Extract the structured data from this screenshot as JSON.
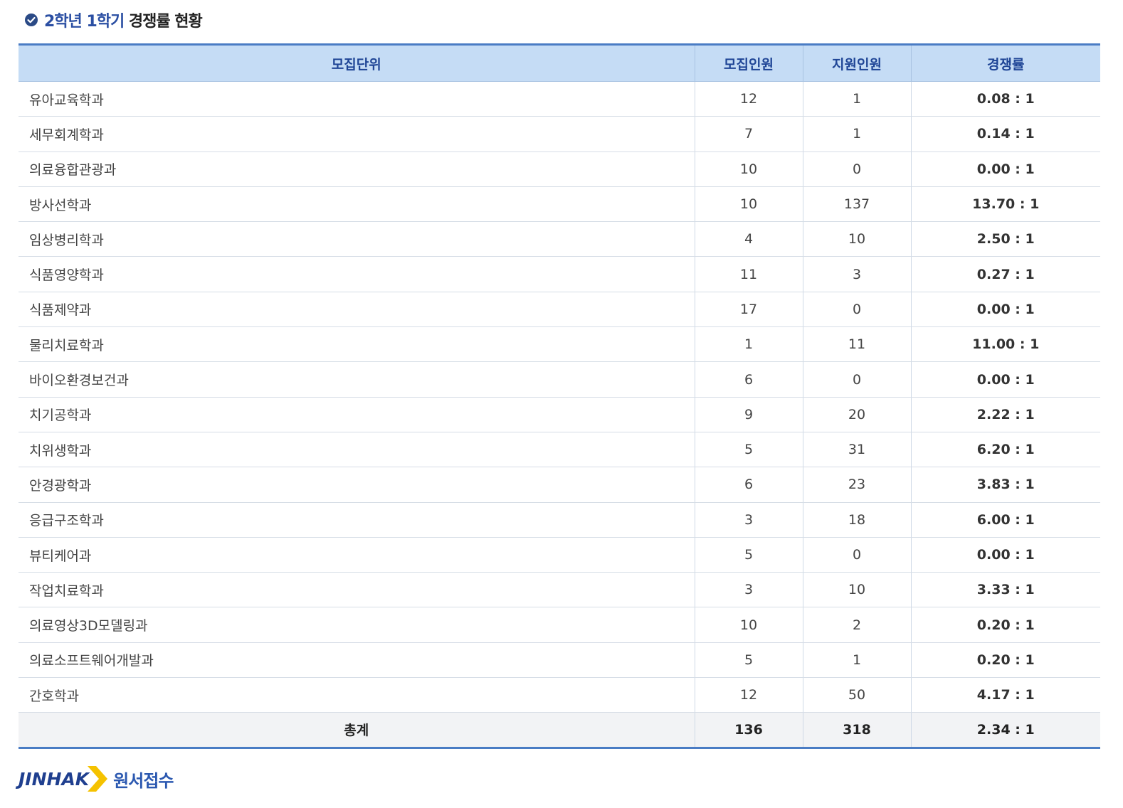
{
  "header": {
    "title_highlight": "2학년 1학기",
    "title_rest": "경쟁률 현황",
    "icon": "check-circle-icon"
  },
  "table": {
    "columns": [
      "모집단위",
      "모집인원",
      "지원인원",
      "경쟁률"
    ],
    "rows": [
      {
        "unit": "유아교육학과",
        "quota": "12",
        "applicants": "1",
        "ratio": "0.08 : 1"
      },
      {
        "unit": "세무회계학과",
        "quota": "7",
        "applicants": "1",
        "ratio": "0.14 : 1"
      },
      {
        "unit": "의료융합관광과",
        "quota": "10",
        "applicants": "0",
        "ratio": "0.00 : 1"
      },
      {
        "unit": "방사선학과",
        "quota": "10",
        "applicants": "137",
        "ratio": "13.70 : 1"
      },
      {
        "unit": "임상병리학과",
        "quota": "4",
        "applicants": "10",
        "ratio": "2.50 : 1"
      },
      {
        "unit": "식품영양학과",
        "quota": "11",
        "applicants": "3",
        "ratio": "0.27 : 1"
      },
      {
        "unit": "식품제약과",
        "quota": "17",
        "applicants": "0",
        "ratio": "0.00 : 1"
      },
      {
        "unit": "물리치료학과",
        "quota": "1",
        "applicants": "11",
        "ratio": "11.00 : 1"
      },
      {
        "unit": "바이오환경보건과",
        "quota": "6",
        "applicants": "0",
        "ratio": "0.00 : 1"
      },
      {
        "unit": "치기공학과",
        "quota": "9",
        "applicants": "20",
        "ratio": "2.22 : 1"
      },
      {
        "unit": "치위생학과",
        "quota": "5",
        "applicants": "31",
        "ratio": "6.20 : 1"
      },
      {
        "unit": "안경광학과",
        "quota": "6",
        "applicants": "23",
        "ratio": "3.83 : 1"
      },
      {
        "unit": "응급구조학과",
        "quota": "3",
        "applicants": "18",
        "ratio": "6.00 : 1"
      },
      {
        "unit": "뷰티케어과",
        "quota": "5",
        "applicants": "0",
        "ratio": "0.00 : 1"
      },
      {
        "unit": "작업치료학과",
        "quota": "3",
        "applicants": "10",
        "ratio": "3.33 : 1"
      },
      {
        "unit": "의료영상3D모델링과",
        "quota": "10",
        "applicants": "2",
        "ratio": "0.20 : 1"
      },
      {
        "unit": "의료소프트웨어개발과",
        "quota": "5",
        "applicants": "1",
        "ratio": "0.20 : 1"
      },
      {
        "unit": "간호학과",
        "quota": "12",
        "applicants": "50",
        "ratio": "4.17 : 1"
      }
    ],
    "total": {
      "label": "총계",
      "quota": "136",
      "applicants": "318",
      "ratio": "2.34 : 1"
    }
  },
  "footer": {
    "brand": "JINHAK",
    "service": "원서접수",
    "arrow_icon": "chevron-right-icon"
  },
  "colors": {
    "accent": "#4a7cc4",
    "header_bg": "#c5dcf5",
    "header_text": "#1f4596",
    "logo_arrow": "#f5c200",
    "total_bg": "#f2f3f5"
  }
}
